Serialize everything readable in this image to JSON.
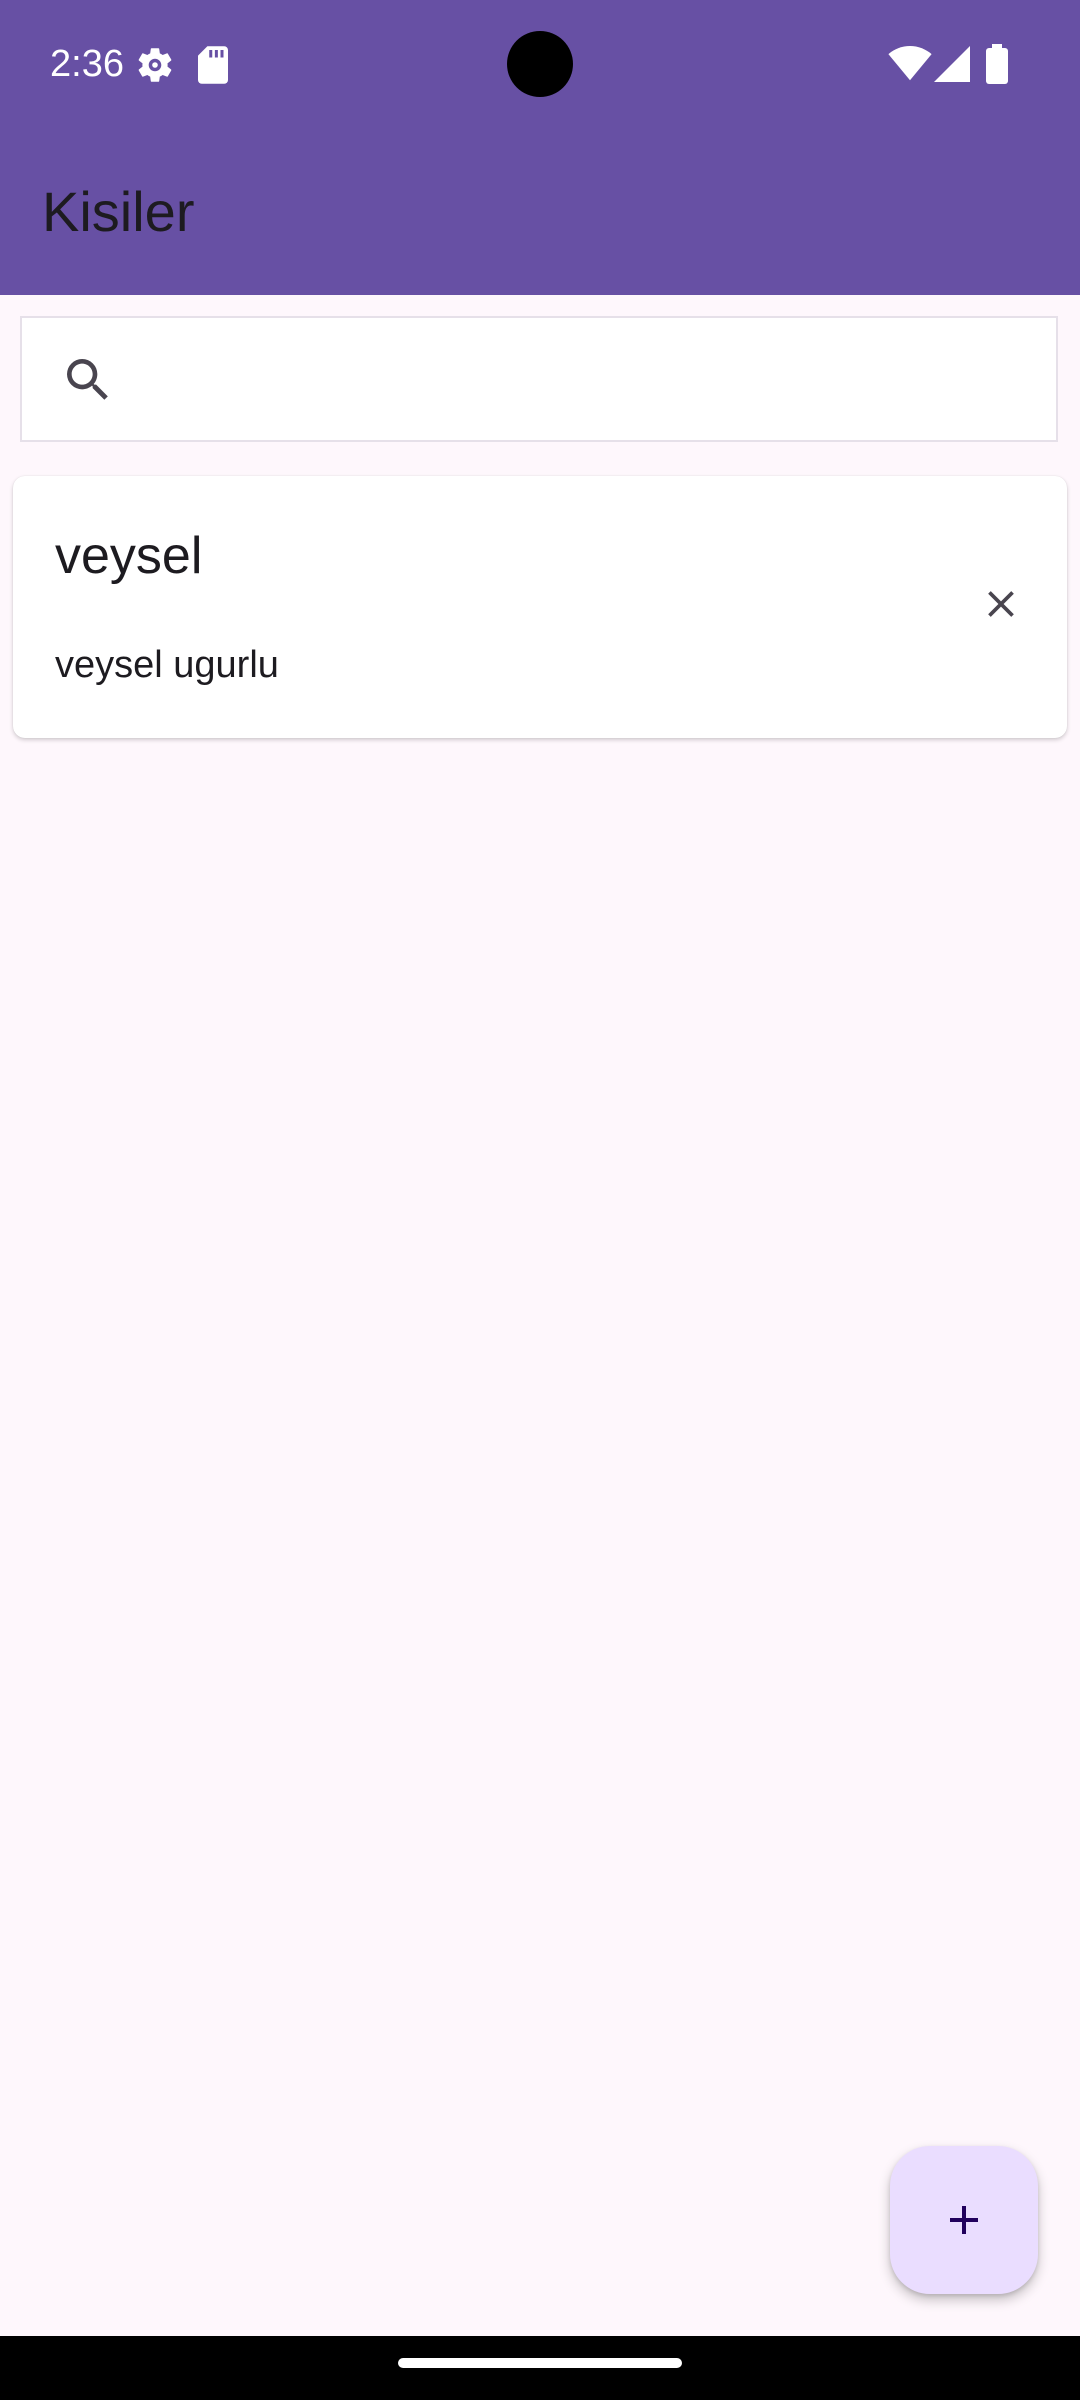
{
  "status_bar": {
    "time": "2:36",
    "icons": [
      "gear-icon",
      "sd-card-icon",
      "wifi-icon",
      "signal-icon",
      "battery-icon"
    ]
  },
  "app_bar": {
    "title": "Kisiler",
    "color": "#6750A4"
  },
  "search": {
    "placeholder": "",
    "value": "",
    "icon": "search-icon"
  },
  "contacts": [
    {
      "name": "veysel",
      "phone": "veysel ugurlu",
      "action_icon": "close-icon"
    }
  ],
  "fab": {
    "icon": "plus-icon",
    "color": "#EADDFF"
  },
  "colors": {
    "background": "#FEF7FC",
    "text": "#1D1B20",
    "icon": "#49454F"
  }
}
